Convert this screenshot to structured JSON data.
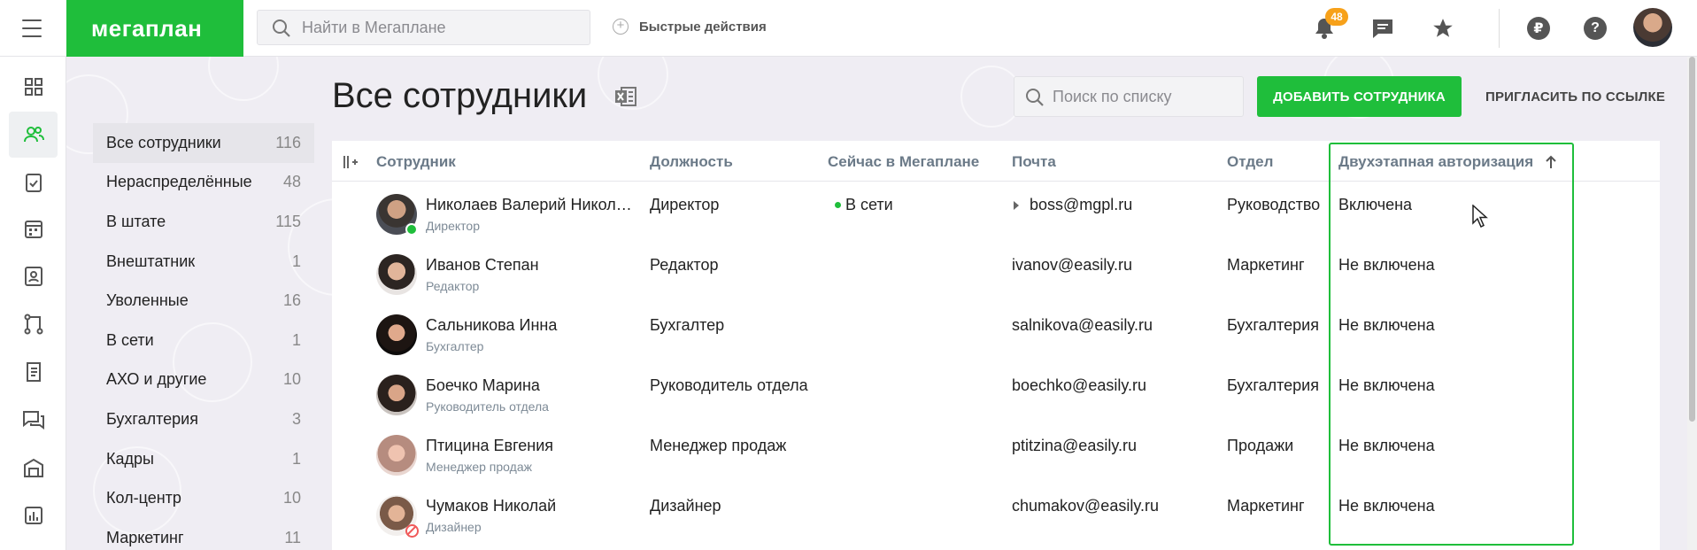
{
  "app": {
    "logo": "мегаплан",
    "search_placeholder": "Найти в Мегаплане",
    "quick_actions": "Быстрые действия",
    "notifications_count": "48",
    "currency_symbol": "₽",
    "help_symbol": "?",
    "accent_color": "#1fbe3b"
  },
  "rail": {
    "icons": [
      "dashboard-icon",
      "employees-icon",
      "tasks-icon",
      "calendar-icon",
      "contacts-icon",
      "processes-icon",
      "documents-icon",
      "discussions-icon",
      "warehouse-icon",
      "reports-icon"
    ],
    "active": "employees-icon"
  },
  "lists": [
    {
      "label": "Все сотрудники",
      "count": "116",
      "active": true
    },
    {
      "label": "Нераспределённые",
      "count": "48"
    },
    {
      "label": "В штате",
      "count": "115"
    },
    {
      "label": "Внештатник",
      "count": "1"
    },
    {
      "label": "Уволенные",
      "count": "16"
    },
    {
      "label": "В сети",
      "count": "1"
    },
    {
      "label": "АХО и другие",
      "count": "10"
    },
    {
      "label": "Бухгалтерия",
      "count": "3"
    },
    {
      "label": "Кадры",
      "count": "1"
    },
    {
      "label": "Кол-центр",
      "count": "10"
    },
    {
      "label": "Маркетинг",
      "count": "11"
    }
  ],
  "page": {
    "title": "Все сотрудники",
    "list_search_placeholder": "Поиск по списку",
    "add_button": "ДОБАВИТЬ СОТРУДНИКА",
    "invite_link": "ПРИГЛАСИТЬ ПО ССЫЛКЕ"
  },
  "table": {
    "columns": [
      "Сотрудник",
      "Должность",
      "Сейчас в Мегаплане",
      "Почта",
      "Отдел",
      "Двухэтапная авторизация"
    ],
    "sorted_column": "Двухэтапная авторизация",
    "sort_direction": "ascending",
    "rows": [
      {
        "name": "Николаев Валерий Никола…",
        "subtitle": "Директор",
        "position": "Директор",
        "online": "В сети",
        "email": "boss@mgpl.ru",
        "department": "Руководство",
        "two_factor": "Включена",
        "status": "online"
      },
      {
        "name": "Иванов Степан",
        "subtitle": "Редактор",
        "position": "Редактор",
        "online": "",
        "email": "ivanov@easily.ru",
        "department": "Маркетинг",
        "two_factor": "Не включена"
      },
      {
        "name": "Сальникова Инна",
        "subtitle": "Бухгалтер",
        "position": "Бухгалтер",
        "online": "",
        "email": "salnikova@easily.ru",
        "department": "Бухгалтерия",
        "two_factor": "Не включена"
      },
      {
        "name": "Боечко Марина",
        "subtitle": "Руководитель отдела",
        "position": "Руководитель отдела",
        "online": "",
        "email": "boechko@easily.ru",
        "department": "Бухгалтерия",
        "two_factor": "Не включена"
      },
      {
        "name": "Птицина Евгения",
        "subtitle": "Менеджер продаж",
        "position": "Менеджер продаж",
        "online": "",
        "email": "ptitzina@easily.ru",
        "department": "Продажи",
        "two_factor": "Не включена"
      },
      {
        "name": "Чумаков Николай",
        "subtitle": "Дизайнер",
        "position": "Дизайнер",
        "online": "",
        "email": "chumakov@easily.ru",
        "department": "Маркетинг",
        "two_factor": "Не включена",
        "status": "blocked"
      }
    ]
  }
}
